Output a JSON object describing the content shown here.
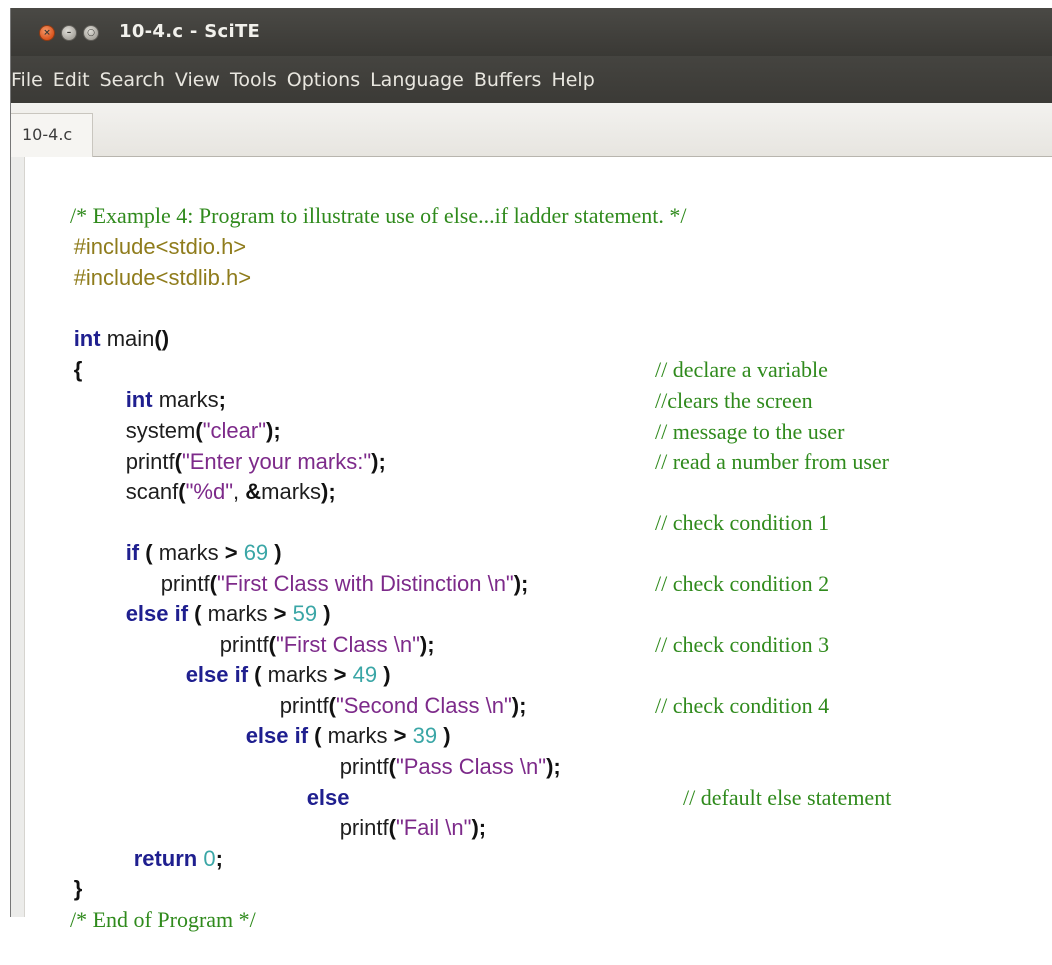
{
  "window": {
    "title": "10-4.c - SciTE"
  },
  "menubar": {
    "items": [
      "File",
      "Edit",
      "Search",
      "View",
      "Tools",
      "Options",
      "Language",
      "Buffers",
      "Help"
    ]
  },
  "tabs": [
    {
      "label": "10-4.c"
    }
  ],
  "colors": {
    "titlebar": "#3f3e3a",
    "keyword": "#1f1f8f",
    "string": "#7d2a8a",
    "number": "#3aa6a6",
    "preprocessor": "#8f7c1c",
    "comment": "#2f8a1c"
  },
  "code": {
    "header_comment": "/* Example 4: Program to illustrate use of else...if ladder statement. */",
    "include1": "#include<stdio.h>",
    "include2": "#include<stdlib.h>",
    "kw_int": "int",
    "main_name": " main",
    "main_parens": "()",
    "brace_open": "{",
    "decl_name": " marks",
    "semicolon": ";",
    "fn_system": "system",
    "fn_printf": "printf",
    "fn_scanf": "scanf",
    "paren_open": "(",
    "paren_close_semi": ");",
    "str_clear": "\"clear\"",
    "str_enter": "\"Enter your marks:\"",
    "str_fmt": "\"%d\"",
    "comma": ", ",
    "ampersand": "&",
    "marks": "marks",
    "kw_if": "if",
    "kw_else_if": "else if",
    "kw_else": "else",
    "cond_open": " ( ",
    "marks_gt": "marks ",
    "gt": ">",
    "space": " ",
    "cond_close": " )",
    "num_69": "69",
    "num_59": "59",
    "num_49": "49",
    "num_39": "39",
    "num_0": "0",
    "str_first_dist": "\"First Class with Distinction \\n\"",
    "str_first": "\"First Class \\n\"",
    "str_second": "\"Second Class \\n\"",
    "str_pass": "\"Pass Class \\n\"",
    "str_fail": "\"Fail \\n\"",
    "kw_return": "return",
    "brace_close": "}",
    "end_comment": "/* End of Program */",
    "comments": {
      "declare": "// declare a variable",
      "clears": "//clears the screen",
      "message": "// message to the user",
      "read": "// read a number from user",
      "cond1": "// check condition 1",
      "cond2": "// check condition 2",
      "cond3": "// check condition 3",
      "cond4": "// check condition 4",
      "default": "// default else statement"
    }
  }
}
